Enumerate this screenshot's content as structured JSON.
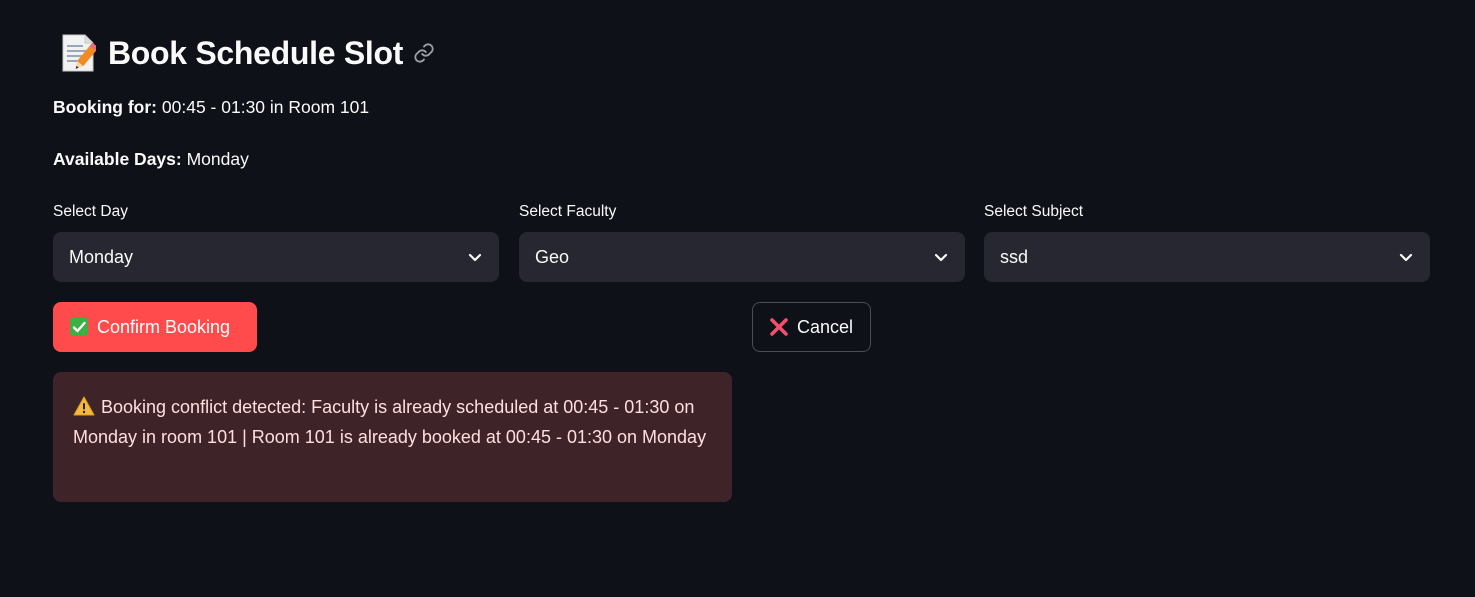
{
  "header": {
    "title": "Book Schedule Slot",
    "title_icon": "memo-icon",
    "anchor_icon": "link-icon"
  },
  "info": {
    "booking_label": "Booking for:",
    "booking_value": "00:45 - 01:30 in Room 101",
    "days_label": "Available Days:",
    "days_value": "Monday"
  },
  "fields": {
    "day": {
      "label": "Select Day",
      "value": "Monday"
    },
    "faculty": {
      "label": "Select Faculty",
      "value": "Geo"
    },
    "subject": {
      "label": "Select Subject",
      "value": "ssd"
    }
  },
  "buttons": {
    "confirm_label": "Confirm Booking",
    "confirm_icon": "check-mark-icon",
    "cancel_label": "Cancel",
    "cancel_icon": "cross-mark-icon"
  },
  "alert": {
    "icon": "warning-icon",
    "message": "Booking conflict detected: Faculty is already scheduled at 00:45 - 01:30 on Monday in room 101 | Room 101 is already booked at 00:45 - 01:30 on Monday"
  },
  "colors": {
    "background": "#0e1117",
    "primary": "#ff4b4b",
    "select_bg": "#262730",
    "alert_bg": "#3e2428",
    "alert_text": "#ffdede"
  }
}
